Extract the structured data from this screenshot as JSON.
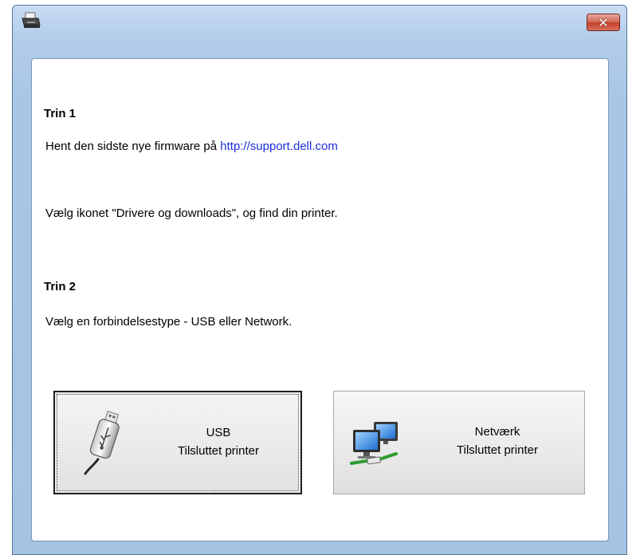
{
  "window": {
    "close_label": "✕"
  },
  "step1": {
    "heading": "Trin 1",
    "line1_prefix": "Hent den sidste nye firmware på ",
    "line1_link": "http://support.dell.com",
    "line2": "Vælg ikonet \"Drivere og downloads\", og find din printer."
  },
  "step2": {
    "heading": "Trin 2",
    "line1": "Vælg en forbindelsestype - USB eller Network."
  },
  "buttons": {
    "usb": {
      "title": "USB",
      "subtitle": "Tilsluttet printer",
      "icon": "usb-drive-icon"
    },
    "network": {
      "title": "Netværk",
      "subtitle": "Tilsluttet printer",
      "icon": "network-computers-icon"
    }
  },
  "colors": {
    "link": "#1a2fd6",
    "close_button": "#c4412c",
    "title_bar": "#b3cdea"
  }
}
